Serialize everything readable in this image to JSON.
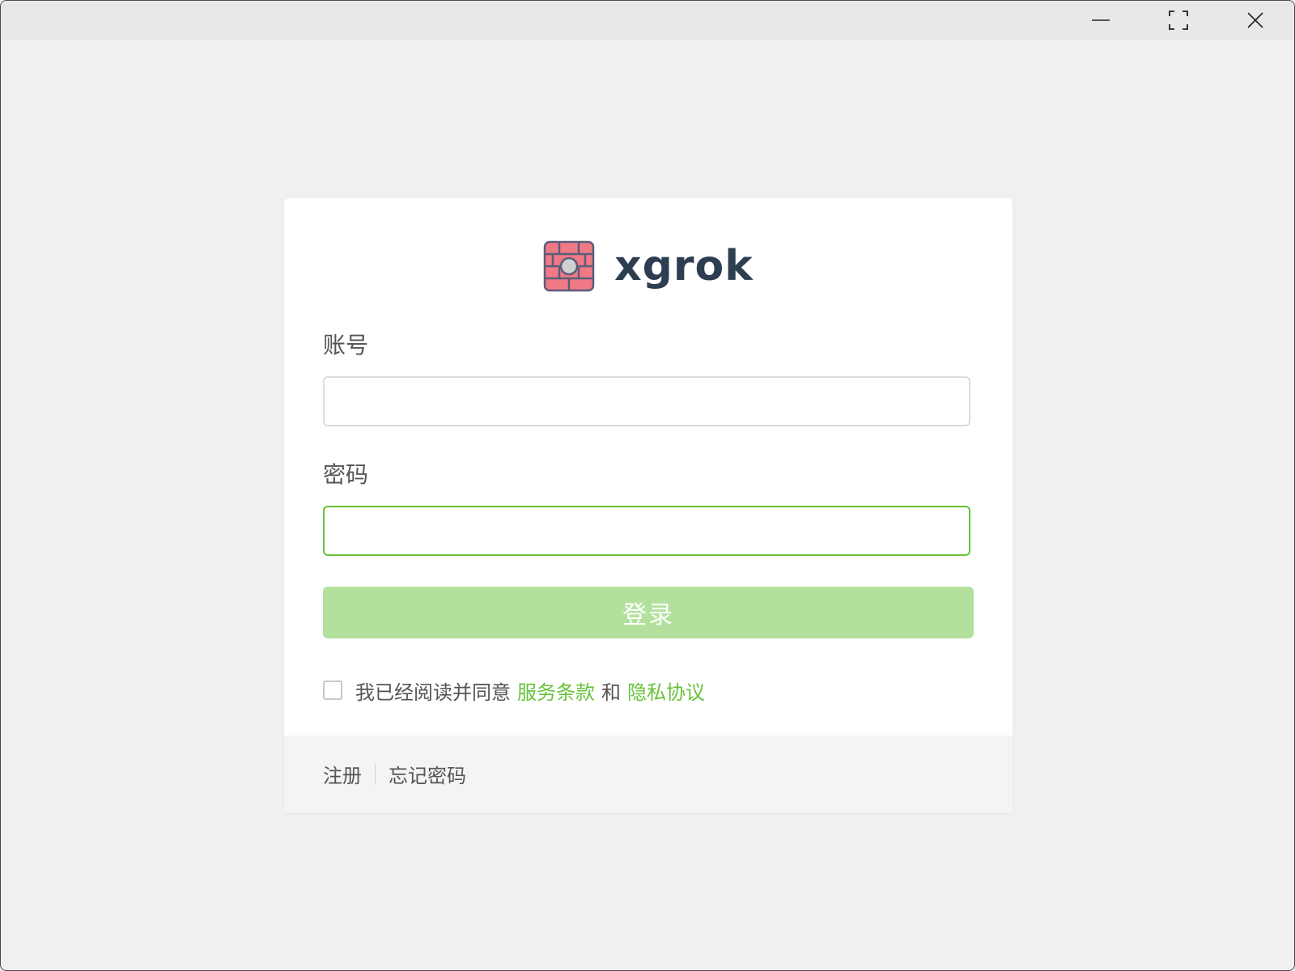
{
  "window": {
    "controls": {
      "minimize_icon": "minimize-icon",
      "maximize_icon": "maximize-icon",
      "close_icon": "close-icon"
    }
  },
  "brand": {
    "logo_icon": "firewall-brick-icon",
    "name": "xgrok",
    "colors": {
      "logo_fill": "#ef7a85",
      "logo_stroke": "#5d5d7a",
      "text": "#2c3e50"
    }
  },
  "form": {
    "account_label": "账号",
    "account_value": "",
    "password_label": "密码",
    "password_value": "",
    "login_label": "登录",
    "agree": {
      "checked": false,
      "prefix": "我已经阅读并同意",
      "terms_link": "服务条款",
      "conjunction": "和",
      "privacy_link": "隐私协议"
    }
  },
  "footer": {
    "register_label": "注册",
    "forgot_label": "忘记密码"
  },
  "theme": {
    "accent": "#67c23a",
    "button_disabled": "#b3e19d",
    "background": "#f0f0f0",
    "card": "#ffffff",
    "footer_bg": "#f4f4f4"
  }
}
